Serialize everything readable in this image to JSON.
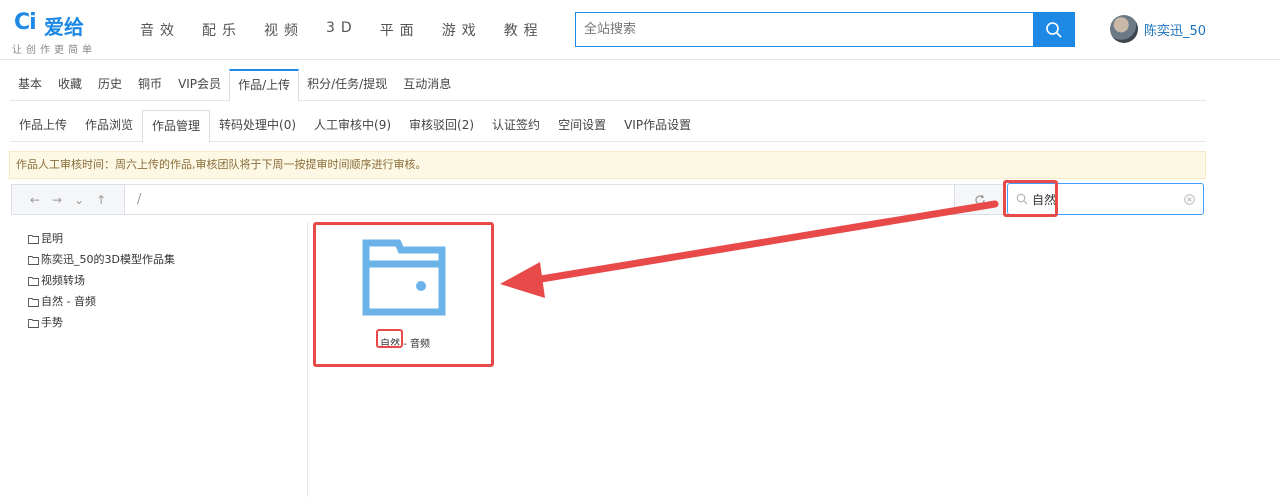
{
  "brand": {
    "logo_mark": "Ci",
    "name": "爱给",
    "slogan": "让创作更简单"
  },
  "main_nav": [
    "音效",
    "配乐",
    "视频",
    "3D",
    "平面",
    "游戏",
    "教程"
  ],
  "search": {
    "placeholder": "全站搜索"
  },
  "user": {
    "name": "陈奕迅_50"
  },
  "tabs_primary": [
    "基本",
    "收藏",
    "历史",
    "铜币",
    "VIP会员",
    "作品/上传",
    "积分/任务/提现",
    "互动消息"
  ],
  "tabs_secondary": [
    "作品上传",
    "作品浏览",
    "作品管理",
    "转码处理中(0)",
    "人工审核中(9)",
    "审核驳回(2)",
    "认证签约",
    "空间设置",
    "VIP作品设置"
  ],
  "notice": "作品人工审核时间：周六上传的作品,审核团队将于下周一按提审时间顺序进行审核。",
  "path": "/",
  "file_search": {
    "value": "自然"
  },
  "folders": [
    "昆明",
    "陈奕迅_50的3D模型作品集",
    "视频转场",
    "自然 - 音频",
    "手势"
  ],
  "files": [
    {
      "name": "自然 - 音频"
    }
  ],
  "colors": {
    "accent": "#1e88e5",
    "highlight": "#e84a4a",
    "folder": "#6bb3e8"
  }
}
